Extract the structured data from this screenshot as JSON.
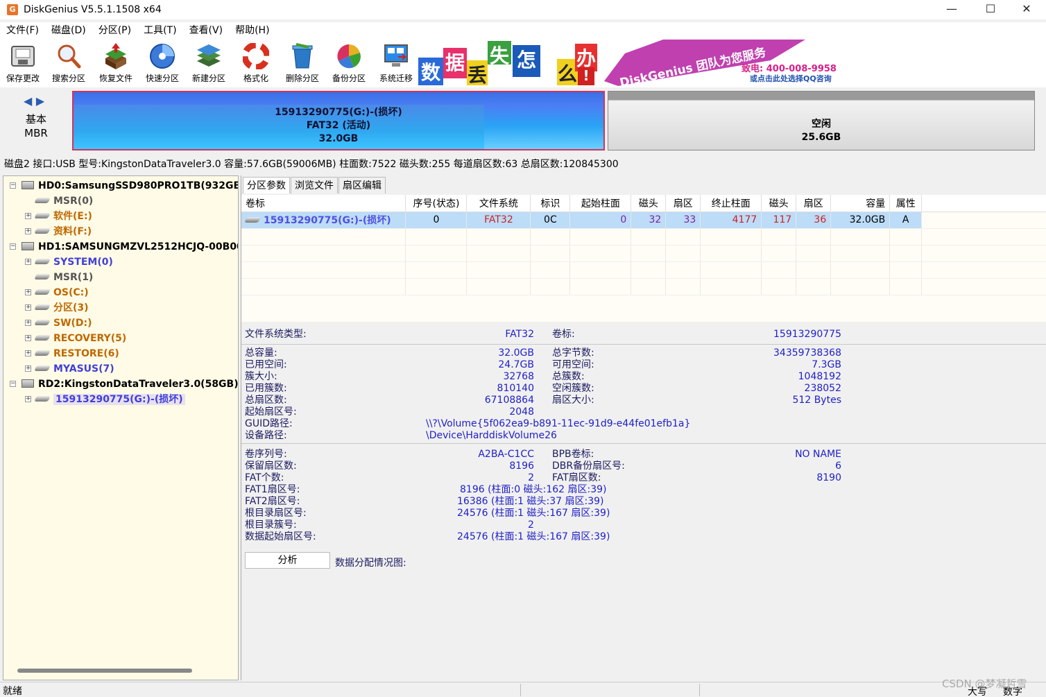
{
  "window": {
    "title": "DiskGenius V5.5.1.1508 x64",
    "app_icon": "G",
    "controls": {
      "minimize": "—",
      "maximize": "☐",
      "close": "✕"
    }
  },
  "menu": [
    "文件(F)",
    "磁盘(D)",
    "分区(P)",
    "工具(T)",
    "查看(V)",
    "帮助(H)"
  ],
  "toolbar": [
    {
      "label": "保存更改",
      "icon": "save-disk-icon"
    },
    {
      "label": "搜索分区",
      "icon": "magnifier-icon"
    },
    {
      "label": "恢复文件",
      "icon": "recover-files-icon"
    },
    {
      "label": "快速分区",
      "icon": "quick-partition-disc-icon"
    },
    {
      "label": "新建分区",
      "icon": "new-partition-layers-icon"
    },
    {
      "label": "格式化",
      "icon": "format-lifebuoy-icon"
    },
    {
      "label": "删除分区",
      "icon": "delete-trash-icon"
    },
    {
      "label": "备份分区",
      "icon": "backup-pie-icon"
    },
    {
      "label": "系统迁移",
      "icon": "system-migration-icon"
    }
  ],
  "banner": {
    "chars": [
      "数",
      "据",
      "丢",
      "失",
      "怎",
      "么",
      "办",
      "!"
    ],
    "brand": "DiskGenius 团队为您服务",
    "phone": "致电: 400-008-9958",
    "qq": "或点击此处选择QQ咨询"
  },
  "diskmap": {
    "nav": "◀ ▶",
    "type_line1": "基本",
    "type_line2": "MBR",
    "partition": {
      "line1": "15913290775(G:)-(损坏)",
      "line2": "FAT32 (活动)",
      "line3": "32.0GB"
    },
    "free": {
      "line1": "空闲",
      "line2": "25.6GB"
    }
  },
  "disk_info": "磁盘2 接口:USB  型号:KingstonDataTraveler3.0  容量:57.6GB(59006MB)  柱面数:7522  磁头数:255  每道扇区数:63  总扇区数:120845300",
  "tree": [
    {
      "label": "HD0:SamsungSSD980PRO1TB(932GB)",
      "kind": "disk",
      "color": "dark",
      "expander": "−"
    },
    {
      "label": "MSR(0)",
      "kind": "part",
      "color": "gray",
      "expander": ""
    },
    {
      "label": "软件(E:)",
      "kind": "part",
      "color": "orange",
      "expander": "+"
    },
    {
      "label": "资料(F:)",
      "kind": "part",
      "color": "orange",
      "expander": "+"
    },
    {
      "label": "HD1:SAMSUNGMZVL2512HCJQ-00B00",
      "kind": "disk",
      "color": "dark",
      "expander": "−"
    },
    {
      "label": "SYSTEM(0)",
      "kind": "part",
      "color": "blue",
      "expander": "+"
    },
    {
      "label": "MSR(1)",
      "kind": "part",
      "color": "gray",
      "expander": ""
    },
    {
      "label": "OS(C:)",
      "kind": "part",
      "color": "orange",
      "expander": "+"
    },
    {
      "label": "分区(3)",
      "kind": "part",
      "color": "orange",
      "expander": "+"
    },
    {
      "label": "SW(D:)",
      "kind": "part",
      "color": "orange",
      "expander": "+"
    },
    {
      "label": "RECOVERY(5)",
      "kind": "part",
      "color": "orange",
      "expander": "+"
    },
    {
      "label": "RESTORE(6)",
      "kind": "part",
      "color": "orange",
      "expander": "+"
    },
    {
      "label": "MYASUS(7)",
      "kind": "part",
      "color": "blue",
      "expander": "+"
    },
    {
      "label": "RD2:KingstonDataTraveler3.0(58GB)",
      "kind": "disk",
      "color": "dark",
      "expander": "−"
    },
    {
      "label": "15913290775(G:)-(损坏)",
      "kind": "part",
      "color": "blue",
      "expander": "+",
      "selected": true
    }
  ],
  "tabs": [
    "分区参数",
    "浏览文件",
    "扇区编辑"
  ],
  "grid": {
    "headers": [
      "卷标",
      "序号(状态)",
      "文件系统",
      "标识",
      "起始柱面",
      "磁头",
      "扇区",
      "终止柱面",
      "磁头",
      "扇区",
      "容量",
      "属性"
    ],
    "row": [
      "15913290775(G:)-(损坏)",
      "0",
      "FAT32",
      "0C",
      "0",
      "32",
      "33",
      "4177",
      "117",
      "36",
      "32.0GB",
      "A"
    ]
  },
  "details": {
    "fs_type_label": "文件系统类型:",
    "fs_type": "FAT32",
    "vol_label_label": "卷标:",
    "vol_label": "15913290775",
    "total_cap_label": "总容量:",
    "total_cap": "32.0GB",
    "total_bytes_label": "总字节数:",
    "total_bytes": "34359738368",
    "used_label": "已用空间:",
    "used": "24.7GB",
    "free_label": "可用空间:",
    "free": "7.3GB",
    "cluster_size_label": "簇大小:",
    "cluster_size": "32768",
    "total_clusters_label": "总簇数:",
    "total_clusters": "1048192",
    "used_clusters_label": "已用簇数:",
    "used_clusters": "810140",
    "free_clusters_label": "空闲簇数:",
    "free_clusters": "238052",
    "total_sectors_label": "总扇区数:",
    "total_sectors": "67108864",
    "sector_size_label": "扇区大小:",
    "sector_size": "512 Bytes",
    "start_sector_label": "起始扇区号:",
    "start_sector": "2048",
    "guid_label": "GUID路径:",
    "guid": "\\\\?\\Volume{5f062ea9-b891-11ec-91d9-e44fe01efb1a}",
    "device_label": "设备路径:",
    "device": "\\Device\\HarddiskVolume26",
    "serial_label": "卷序列号:",
    "serial": "A2BA-C1CC",
    "bpb_label": "BPB卷标:",
    "bpb": "NO NAME",
    "reserved_label": "保留扇区数:",
    "reserved": "8196",
    "dbr_label": "DBR备份扇区号:",
    "dbr": "6",
    "fat_count_label": "FAT个数:",
    "fat_count": "2",
    "fat_sectors_label": "FAT扇区数:",
    "fat_sectors": "8190",
    "fat1_label": "FAT1扇区号:",
    "fat1": "8196 (柱面:0 磁头:162 扇区:39)",
    "fat2_label": "FAT2扇区号:",
    "fat2": "16386 (柱面:1 磁头:37 扇区:39)",
    "root_sector_label": "根目录扇区号:",
    "root_sector": "24576 (柱面:1 磁头:167 扇区:39)",
    "root_cluster_label": "根目录簇号:",
    "root_cluster": "2",
    "data_start_label": "数据起始扇区号:",
    "data_start": "24576 (柱面:1 磁头:167 扇区:39)",
    "analyze_button": "分析",
    "alloc_label": "数据分配情况图:"
  },
  "status": {
    "text": "就绪",
    "large": "大写",
    "num": "数字"
  },
  "watermark": "CSDN @梦凝哲雪"
}
